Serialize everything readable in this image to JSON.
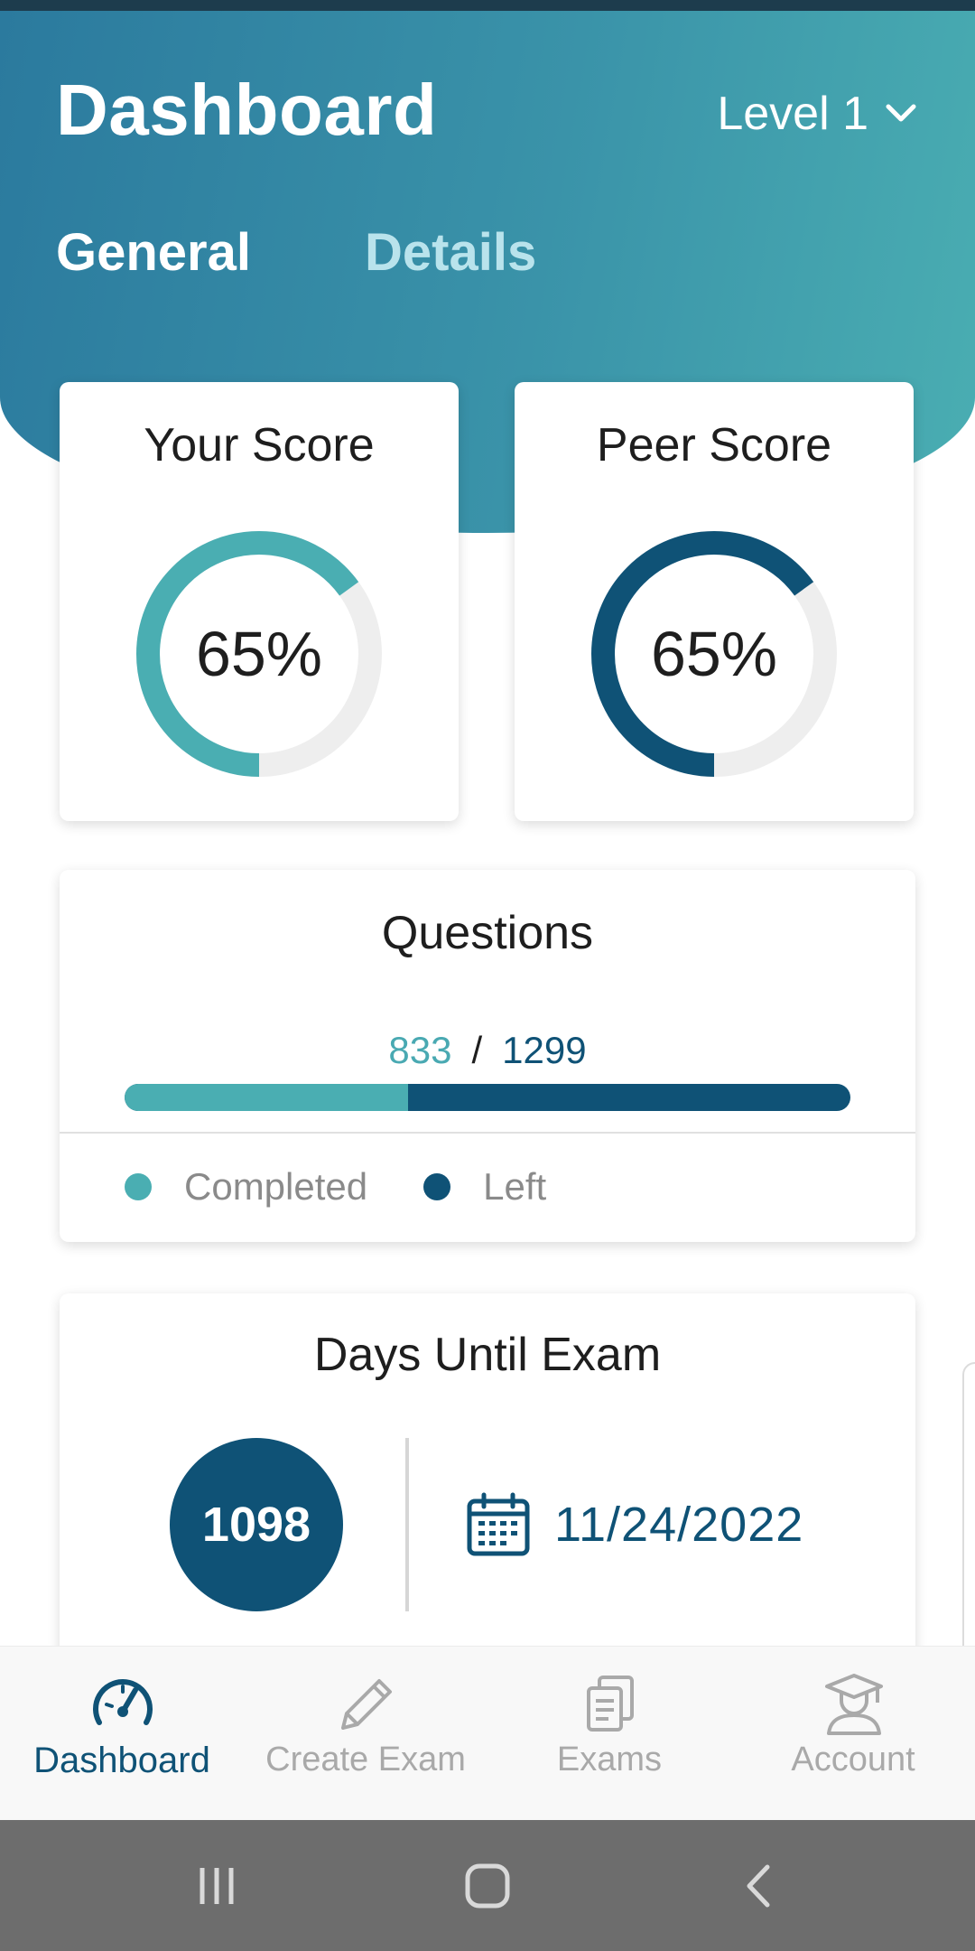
{
  "header": {
    "title": "Dashboard",
    "level_label": "Level 1",
    "tabs": [
      {
        "label": "General",
        "active": true
      },
      {
        "label": "Details",
        "active": false
      }
    ]
  },
  "scores": {
    "your": {
      "title": "Your Score",
      "value_text": "65%",
      "progress": 0.65,
      "color": "#4aaeb2"
    },
    "peer": {
      "title": "Peer Score",
      "value_text": "65%",
      "progress": 0.65,
      "color": "#0f5276"
    }
  },
  "questions": {
    "title": "Questions",
    "completed": "833",
    "total": "1299",
    "separator": "/",
    "progress": 0.39,
    "legend": {
      "completed": "Completed",
      "left": "Left"
    }
  },
  "days": {
    "title": "Days Until Exam",
    "count": "1098",
    "date": "11/24/2022"
  },
  "bottom_nav": {
    "items": [
      {
        "label": "Dashboard",
        "icon": "speedometer-icon",
        "active": true
      },
      {
        "label": "Create Exam",
        "icon": "pencil-icon",
        "active": false
      },
      {
        "label": "Exams",
        "icon": "documents-icon",
        "active": false
      },
      {
        "label": "Account",
        "icon": "graduate-icon",
        "active": false
      }
    ]
  },
  "colors": {
    "accent_teal": "#4aaeb2",
    "accent_navy": "#0f5276",
    "track": "#eeeeee"
  }
}
